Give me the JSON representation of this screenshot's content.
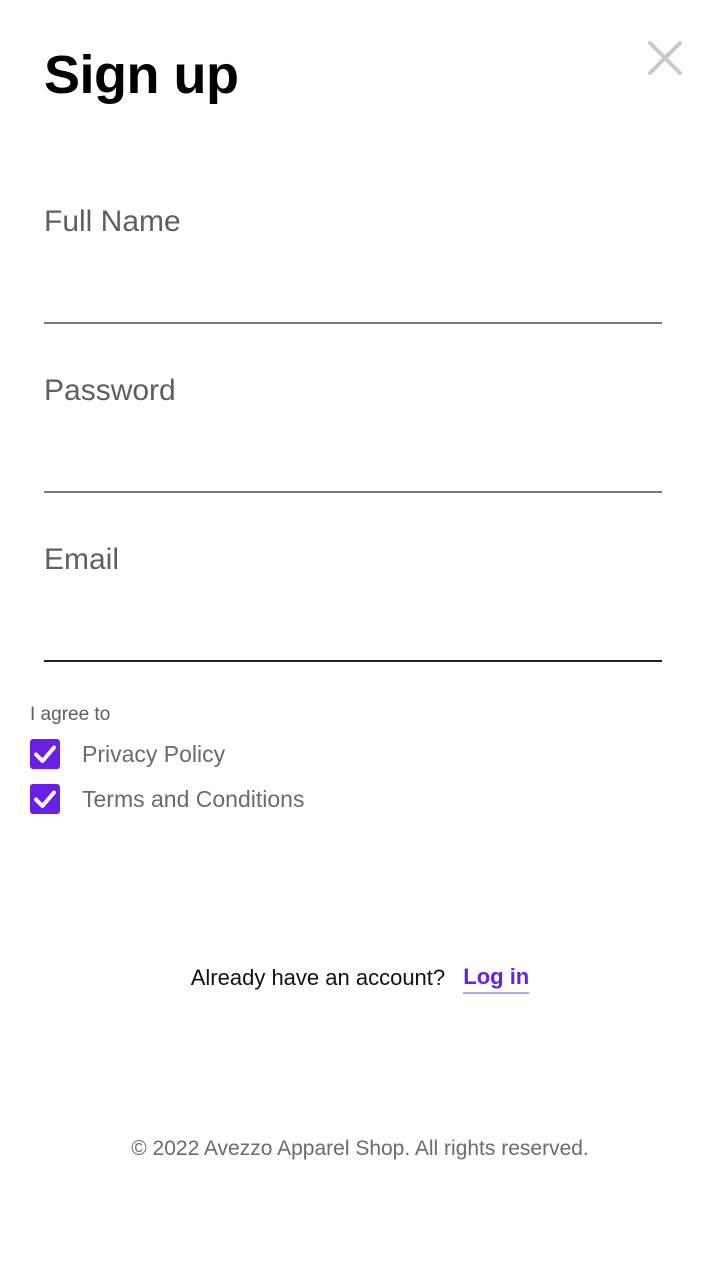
{
  "header": {
    "title": "Sign up",
    "close_icon": "close-icon"
  },
  "form": {
    "full_name": {
      "label": "Full Name",
      "value": ""
    },
    "password": {
      "label": "Password",
      "value": ""
    },
    "email": {
      "label": "Email",
      "value": ""
    }
  },
  "agreement": {
    "heading": "I agree to",
    "items": [
      {
        "label": "Privacy Policy",
        "checked": true
      },
      {
        "label": "Terms and Conditions",
        "checked": true
      }
    ]
  },
  "login": {
    "prompt": "Already have an account?",
    "link_label": "Log in"
  },
  "footer": {
    "copyright": "© 2022 Avezzo Apparel Shop. All rights reserved."
  },
  "colors": {
    "accent": "#6a1fe6",
    "label": "#5f5f5f",
    "close_icon": "#c8c8c8",
    "text": "#000000"
  }
}
